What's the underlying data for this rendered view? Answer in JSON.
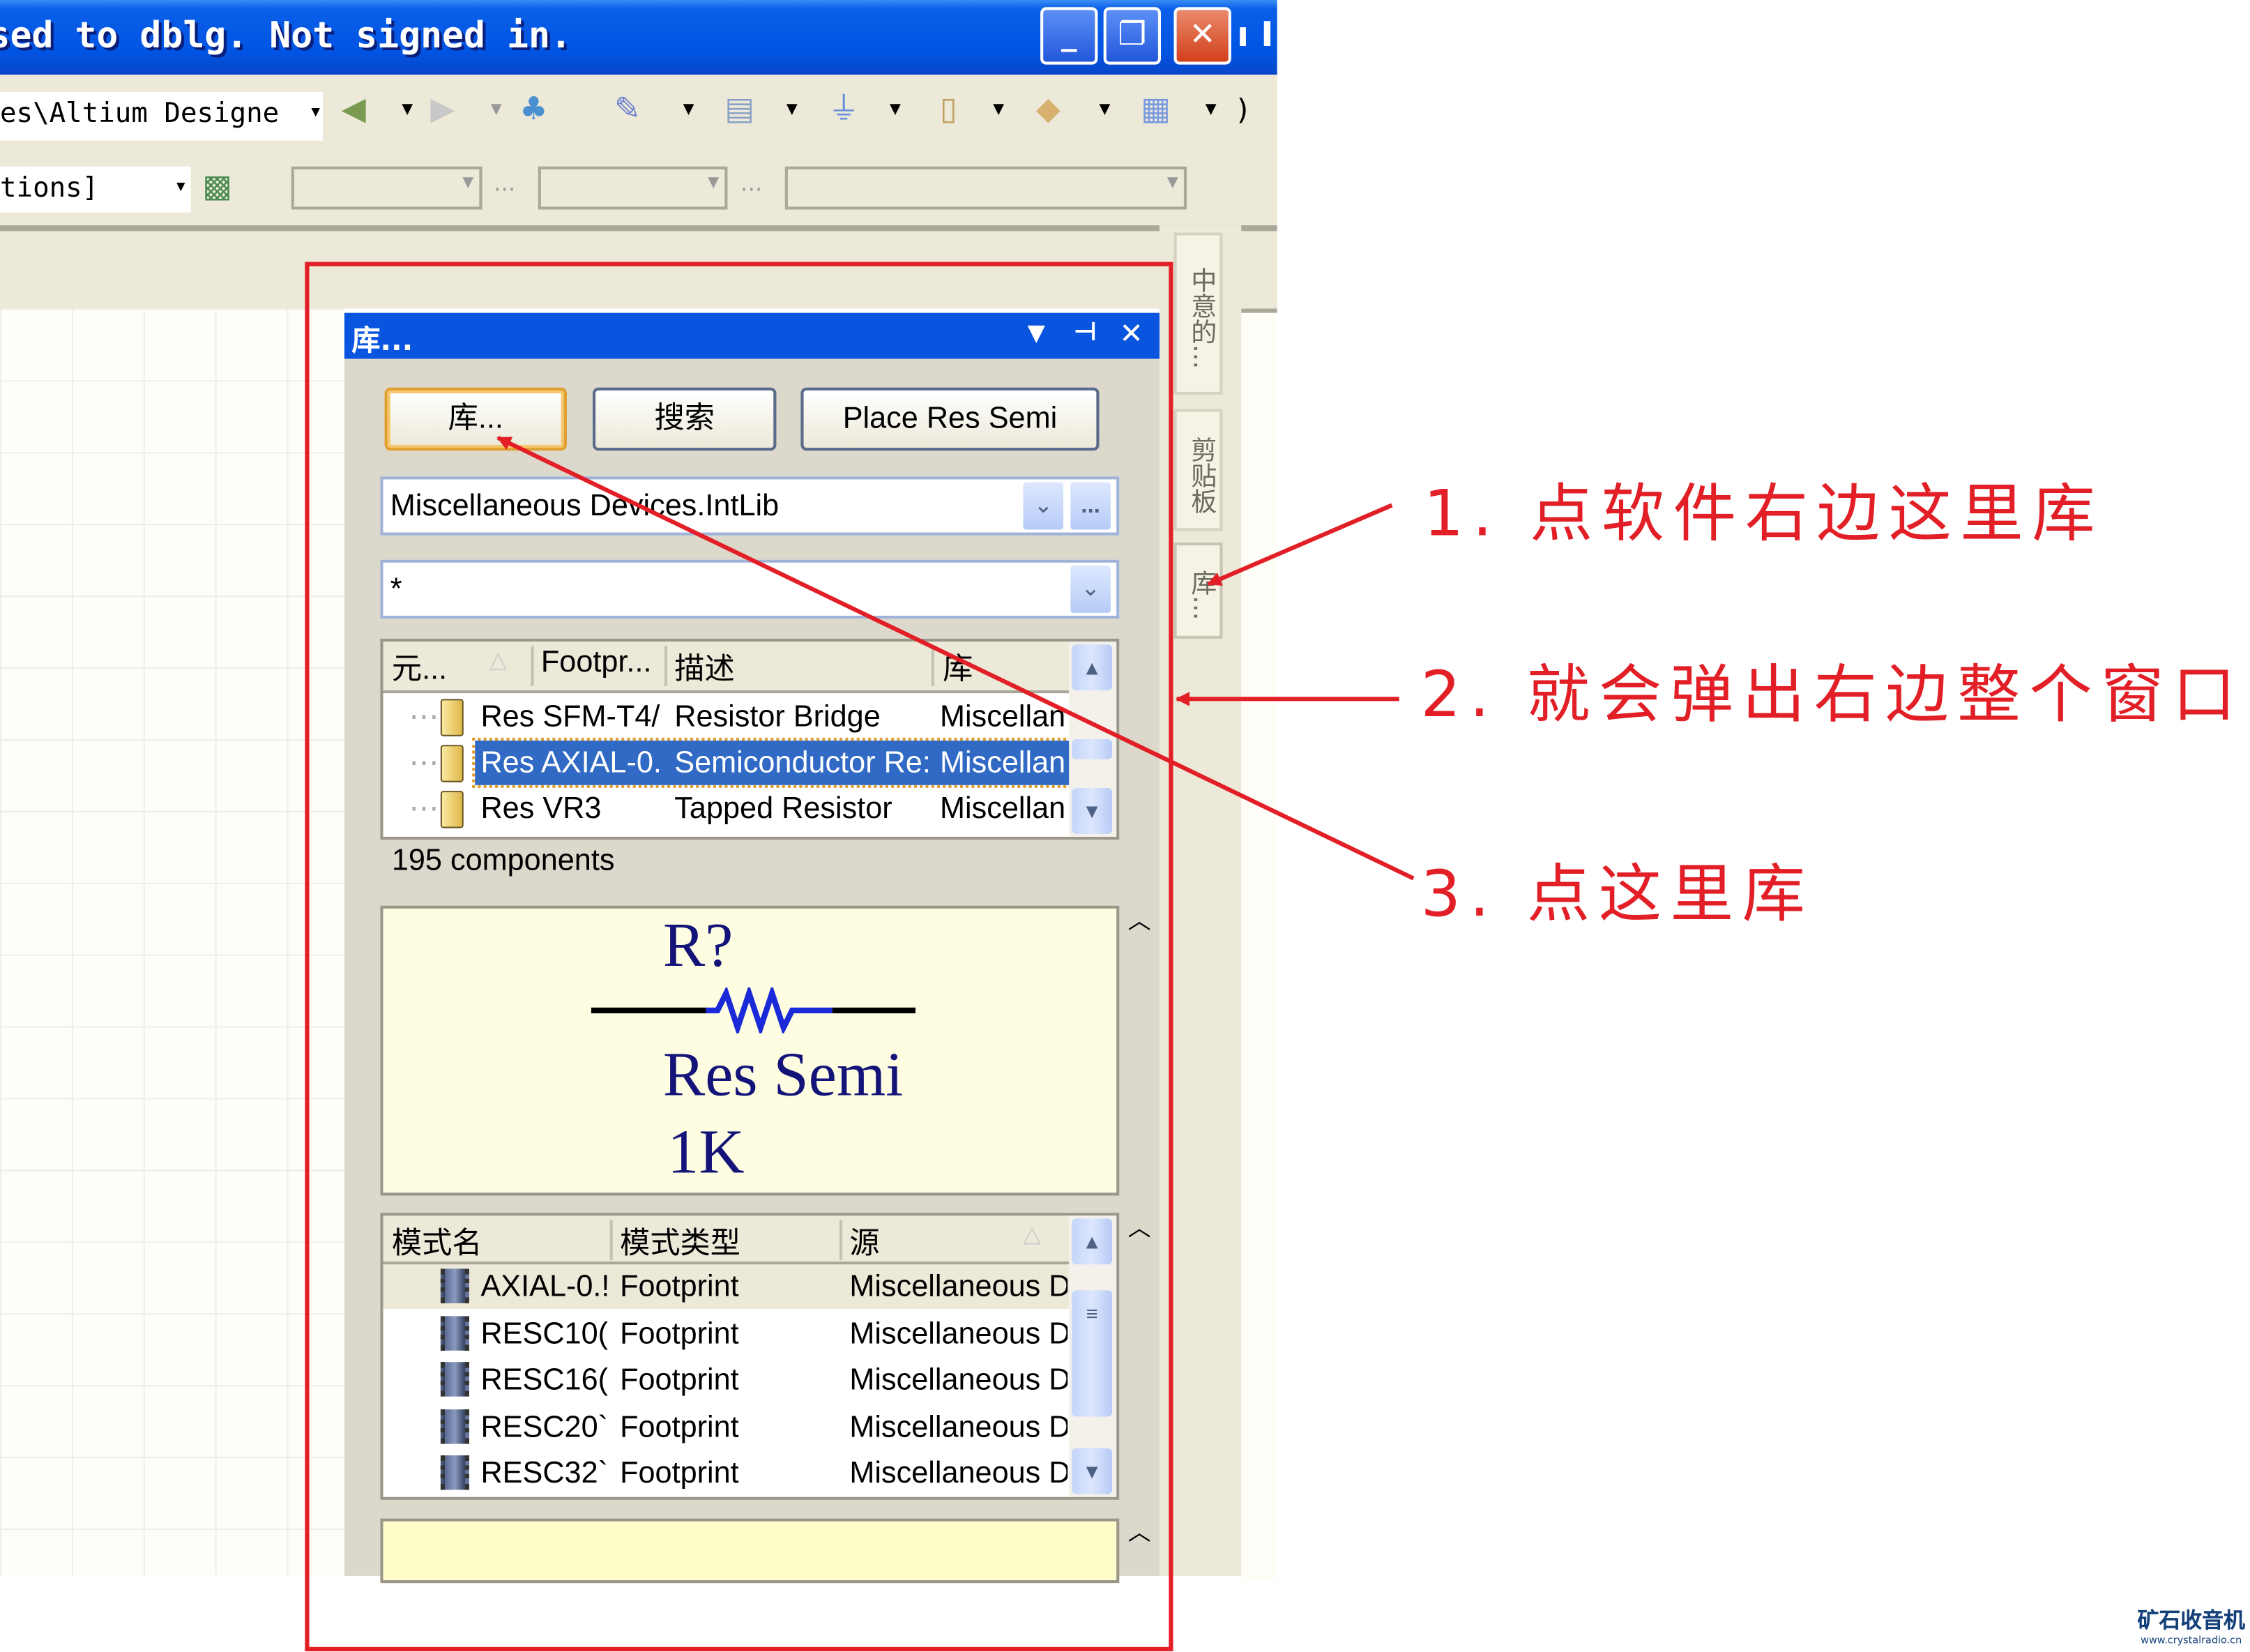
{
  "window": {
    "title": "sed to dblg. Not signed in.",
    "title_overflow": "ı I",
    "buttons": [
      "minimize",
      "restore",
      "close"
    ]
  },
  "toolbar1": {
    "path_combo": "es\\Altium Designe",
    "icons": [
      "back-icon",
      "forward-icon",
      "tree-icon",
      "wire-tool-icon",
      "bus-icon",
      "ground-icon",
      "component-icon",
      "port-icon",
      "grid-icon"
    ],
    "overflow": ")"
  },
  "toolbar2": {
    "combo": "tions]",
    "ellipsis": "..."
  },
  "side_tabs": [
    "中意的...",
    "剪贴板",
    "库..."
  ],
  "panel": {
    "title": "库...",
    "buttons": {
      "libraries": "库...",
      "search": "搜索",
      "place": "Place Res Semi"
    },
    "library_select": "Miscellaneous Devices.IntLib",
    "browse": "...",
    "filter": "*",
    "components": {
      "columns": [
        "元...",
        "Footpr...",
        "描述",
        "库"
      ],
      "rows": [
        {
          "name": "Res SFM-T4/",
          "footprint": "",
          "description": "Resistor Bridge",
          "library": "Miscellan",
          "selected": false
        },
        {
          "name": "Res AXIAL-0.",
          "footprint": "",
          "description": "Semiconductor Re:",
          "library": "Miscellan",
          "selected": true
        },
        {
          "name": "Res VR3",
          "footprint": "",
          "description": "Tapped Resistor",
          "library": "Miscellan",
          "selected": false
        }
      ],
      "count": "195 components"
    },
    "preview": {
      "designator": "R?",
      "comment": "Res Semi",
      "value": "1K"
    },
    "models": {
      "columns": [
        "模式名",
        "模式类型",
        "源"
      ],
      "rows": [
        {
          "name": "AXIAL-0.!",
          "type": "Footprint",
          "source": "Miscellaneous D"
        },
        {
          "name": "RESC10(",
          "type": "Footprint",
          "source": "Miscellaneous D"
        },
        {
          "name": "RESC16(",
          "type": "Footprint",
          "source": "Miscellaneous D"
        },
        {
          "name": "RESC20`",
          "type": "Footprint",
          "source": "Miscellaneous D"
        },
        {
          "name": "RESC32`",
          "type": "Footprint",
          "source": "Miscellaneous D"
        }
      ]
    }
  },
  "annotations": [
    "1. 点软件右边这里库",
    "2. 就会弹出右边整个窗口",
    "3. 点这里库"
  ],
  "watermark": {
    "name": "矿石收音机",
    "url": "www.crystalradio.cn"
  },
  "colors": {
    "annotation": "#e21f26",
    "titlebar": "#0054e3",
    "selection": "#316ac5",
    "preview_bg": "#fefde2"
  }
}
